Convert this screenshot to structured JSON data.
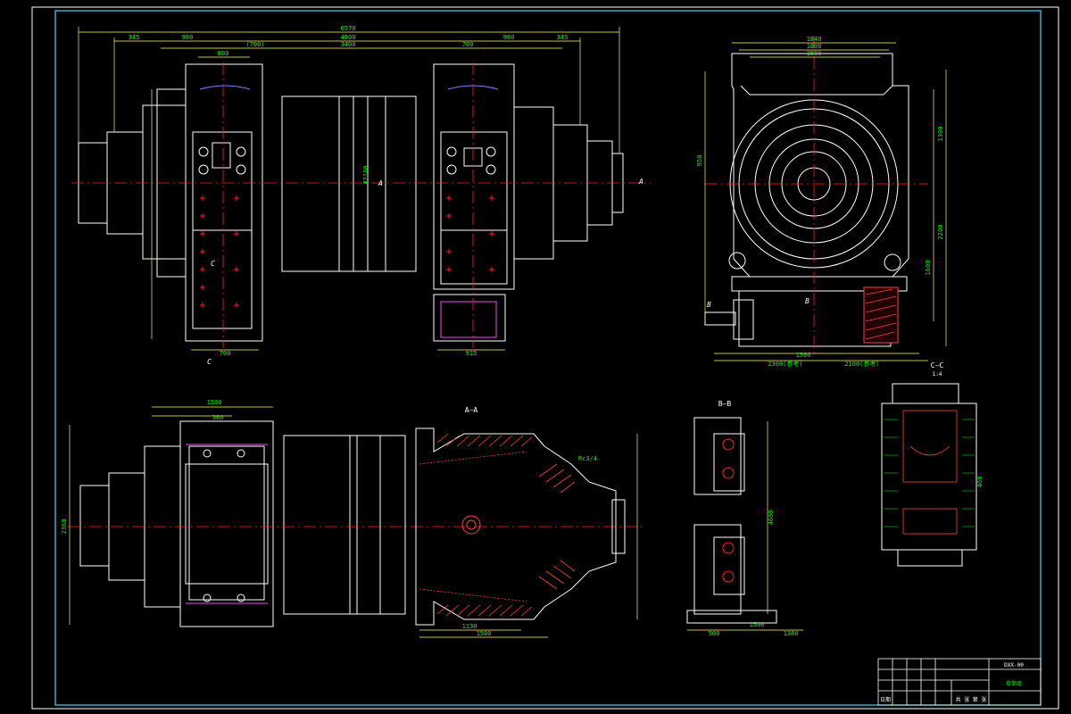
{
  "colors": {
    "background": "#000000",
    "outline": "#ffffff",
    "dimension": "#00ff00",
    "centerline": "#ff2020",
    "hatch": "#ff4040",
    "frame": "#30e0ff",
    "extension": "#ffff40",
    "accent": "#ff40ff"
  },
  "labels": {
    "section_aa": "A—A",
    "section_bb": "B—B",
    "section_cc": "C—C",
    "scale_cc": "1:4",
    "cut_a": "A",
    "cut_b": "B",
    "cut_c": "C",
    "thread": "Rc3/4"
  },
  "dimensions": {
    "top_total": "6570",
    "top_span": "4800",
    "top_inner": "3400",
    "top_700": "(700)",
    "top_700b": "700",
    "top_900a": "900",
    "top_900b": "900",
    "top_345a": "345",
    "top_345b": "345",
    "top_800": "800",
    "dia_drum": "Φ2100",
    "side_1840": "1840",
    "side_1800": "1800",
    "side_1600": "1600",
    "side_1300": "1300",
    "side_2200": "2200",
    "side_1600v": "1600",
    "side_950": "950",
    "side_1560": "1560",
    "side_2100": "2100(参考)",
    "side_2300": "2300(参考)",
    "bot_1500": "1500",
    "bot_2360": "2360",
    "bot_1130": "1130",
    "bot_1500b": "1500",
    "bot_700": "700",
    "bot_360": "360",
    "bb_500": "500",
    "bb_1500": "1500",
    "bb_1380": "1380",
    "bb_4600": "4600",
    "cc_460": "460"
  },
  "title_block": {
    "code": "DXX-00",
    "name": "卷筒组",
    "date_label": "日期",
    "sheet_label": "共 张 第 张"
  }
}
